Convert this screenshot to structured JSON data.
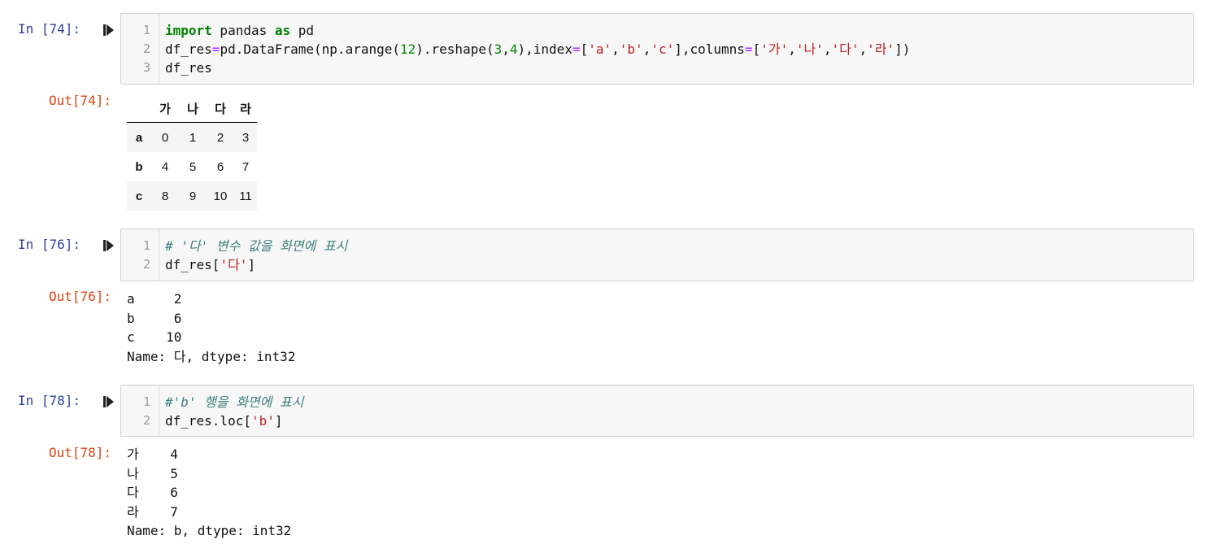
{
  "cells": [
    {
      "in_prompt": "In [74]:",
      "lines": [
        {
          "no": "1"
        },
        {
          "no": "2"
        },
        {
          "no": "3"
        }
      ],
      "out_prompt": "Out[74]:",
      "code": {
        "l1_kw1": "import",
        "l1_mid": " pandas ",
        "l1_kw2": "as",
        "l1_end": " pd",
        "l2_a": "df_res",
        "l2_eq": "=",
        "l2_b": "pd.DataFrame(np.arange(",
        "l2_n1": "12",
        "l2_c": ").reshape(",
        "l2_n2": "3",
        "l2_d": ",",
        "l2_n3": "4",
        "l2_e": "),index",
        "l2_eq2": "=",
        "l2_f": "[",
        "l2_s1": "'a'",
        "l2_g": ",",
        "l2_s2": "'b'",
        "l2_h": ",",
        "l2_s3": "'c'",
        "l2_i": "],columns",
        "l2_eq3": "=",
        "l2_j": "[",
        "l2_s4": "'가'",
        "l2_k": ",",
        "l2_s5": "'나'",
        "l2_l": ",",
        "l2_s6": "'다'",
        "l2_m": ",",
        "l2_s7": "'라'",
        "l2_n": "])",
        "l3": "df_res"
      },
      "dataframe": {
        "columns": [
          "가",
          "나",
          "다",
          "라"
        ],
        "rows": [
          {
            "index": "a",
            "values": [
              "0",
              "1",
              "2",
              "3"
            ]
          },
          {
            "index": "b",
            "values": [
              "4",
              "5",
              "6",
              "7"
            ]
          },
          {
            "index": "c",
            "values": [
              "8",
              "9",
              "10",
              "11"
            ]
          }
        ]
      }
    },
    {
      "in_prompt": "In [76]:",
      "lines": [
        {
          "no": "1"
        },
        {
          "no": "2"
        }
      ],
      "out_prompt": "Out[76]:",
      "code": {
        "l1": "# '다' 변수 값을 화면에 표시",
        "l2_a": "df_res[",
        "l2_s": "'다'",
        "l2_b": "]"
      },
      "output": "a     2\nb     6\nc    10\nName: 다, dtype: int32"
    },
    {
      "in_prompt": "In [78]:",
      "lines": [
        {
          "no": "1"
        },
        {
          "no": "2"
        }
      ],
      "out_prompt": "Out[78]:",
      "code": {
        "l1": "#'b' 행을 화면에 표시",
        "l2_a": "df_res.loc[",
        "l2_s": "'b'",
        "l2_b": "]"
      },
      "output": "가    4\n나    5\n다    6\n라    7\nName: b, dtype: int32"
    }
  ],
  "colors": {
    "in_prompt": "#303f9f",
    "out_prompt": "#d84315",
    "keyword": "#008000",
    "string": "#ba2121",
    "comment": "#408080",
    "cell_bg": "#f7f7f7"
  },
  "icons": {
    "run": "run-cell-icon"
  }
}
